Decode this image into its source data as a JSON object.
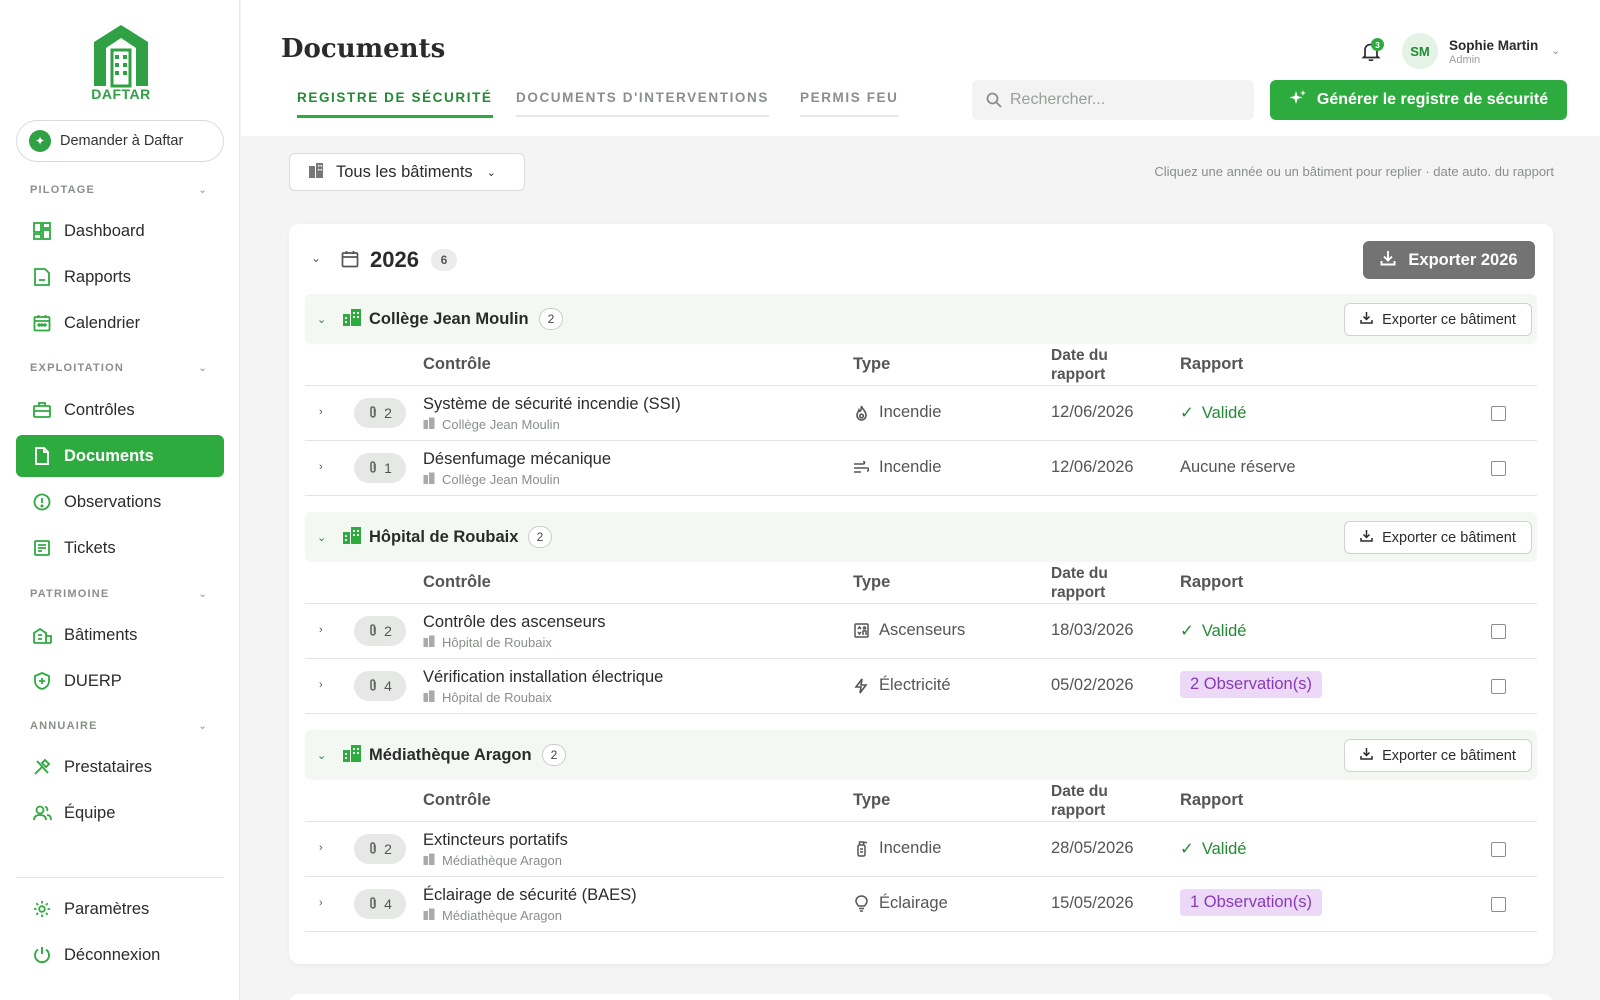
{
  "brand": {
    "name": "DAFTAR",
    "color": "#2eab3f"
  },
  "sidebar": {
    "ask_label": "Demander à Daftar",
    "sections": [
      {
        "label": "PILOTAGE",
        "items": [
          {
            "label": "Dashboard",
            "icon": "dashboard-icon"
          },
          {
            "label": "Rapports",
            "icon": "report-icon"
          },
          {
            "label": "Calendrier",
            "icon": "calendar-icon"
          }
        ]
      },
      {
        "label": "EXPLOITATION",
        "items": [
          {
            "label": "Contrôles",
            "icon": "toolbox-icon"
          },
          {
            "label": "Documents",
            "icon": "document-icon",
            "active": true
          },
          {
            "label": "Observations",
            "icon": "alert-circle-icon"
          },
          {
            "label": "Tickets",
            "icon": "ticket-icon"
          }
        ]
      },
      {
        "label": "PATRIMOINE",
        "items": [
          {
            "label": "Bâtiments",
            "icon": "building-icon"
          },
          {
            "label": "DUERP",
            "icon": "shield-icon"
          }
        ]
      },
      {
        "label": "ANNUAIRE",
        "items": [
          {
            "label": "Prestataires",
            "icon": "tools-icon"
          },
          {
            "label": "Équipe",
            "icon": "team-icon"
          }
        ]
      }
    ],
    "footer": [
      {
        "label": "Paramètres",
        "icon": "gear-icon"
      },
      {
        "label": "Déconnexion",
        "icon": "power-icon"
      }
    ]
  },
  "header": {
    "title": "Documents",
    "tabs": [
      {
        "label": "REGISTRE DE SÉCURITÉ",
        "active": true
      },
      {
        "label": "DOCUMENTS D'INTERVENTIONS"
      },
      {
        "label": "PERMIS FEU"
      }
    ],
    "search_placeholder": "Rechercher...",
    "generate_label": "Générer le registre de sécurité",
    "notifications": "3",
    "user": {
      "initials": "SM",
      "name": "Sophie Martin",
      "role": "Admin"
    }
  },
  "filter": {
    "building_select": "Tous les bâtiments",
    "hint": "Cliquez une année ou un bâtiment pour replier · date auto. du rapport"
  },
  "registry": {
    "year": "2026",
    "count": "6",
    "export_label": "Exporter 2026",
    "columns": {
      "control": "Contrôle",
      "type": "Type",
      "date_line1": "Date du",
      "date_line2": "rapport",
      "report": "Rapport"
    },
    "group_export_label": "Exporter ce bâtiment",
    "groups": [
      {
        "name": "Collège Jean Moulin",
        "count": "2",
        "rows": [
          {
            "attachments": "2",
            "title": "Système de sécurité incendie (SSI)",
            "building": "Collège Jean Moulin",
            "type": "Incendie",
            "type_icon": "fire-icon",
            "date": "12/06/2026",
            "status": "Validé",
            "status_kind": "valid"
          },
          {
            "attachments": "1",
            "title": "Désenfumage mécanique",
            "building": "Collège Jean Moulin",
            "type": "Incendie",
            "type_icon": "smoke-icon",
            "date": "12/06/2026",
            "status": "Aucune réserve",
            "status_kind": "plain"
          }
        ]
      },
      {
        "name": "Hôpital de Roubaix",
        "count": "2",
        "rows": [
          {
            "attachments": "2",
            "title": "Contrôle des ascenseurs",
            "building": "Hôpital de Roubaix",
            "type": "Ascenseurs",
            "type_icon": "elevator-icon",
            "date": "18/03/2026",
            "status": "Validé",
            "status_kind": "valid"
          },
          {
            "attachments": "4",
            "title": "Vérification installation électrique",
            "building": "Hôpital de Roubaix",
            "type": "Électricité",
            "type_icon": "lightning-icon",
            "date": "05/02/2026",
            "status": "2 Observation(s)",
            "status_kind": "obs"
          }
        ]
      },
      {
        "name": "Médiathèque Aragon",
        "count": "2",
        "rows": [
          {
            "attachments": "2",
            "title": "Extincteurs portatifs",
            "building": "Médiathèque Aragon",
            "type": "Incendie",
            "type_icon": "extinguisher-icon",
            "date": "28/05/2026",
            "status": "Validé",
            "status_kind": "valid"
          },
          {
            "attachments": "4",
            "title": "Éclairage de sécurité (BAES)",
            "building": "Médiathèque Aragon",
            "type": "Éclairage",
            "type_icon": "bulb-icon",
            "date": "15/05/2026",
            "status": "1 Observation(s)",
            "status_kind": "obs"
          }
        ]
      }
    ]
  }
}
